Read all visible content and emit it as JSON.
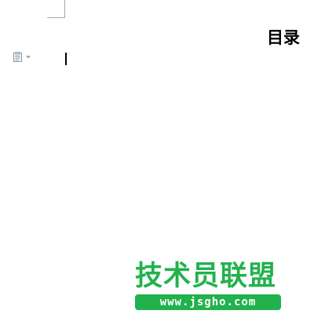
{
  "document": {
    "title": "目录"
  },
  "icons": {
    "paste_options": "paste-options-icon",
    "dropdown": "chevron-down-icon"
  },
  "watermark": {
    "brand": "技术员联盟",
    "url": "www.jsgho.com",
    "color": "#21b24b"
  }
}
